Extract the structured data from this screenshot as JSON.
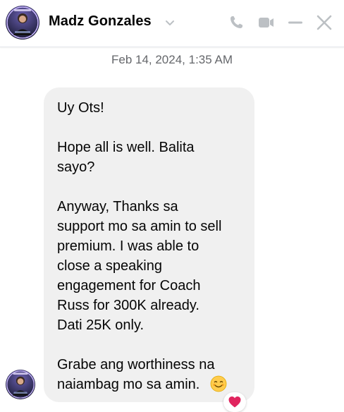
{
  "contact": {
    "name": "Madz Gonzales"
  },
  "header": {
    "icons": [
      "chevron-down-icon",
      "phone-icon",
      "video-icon",
      "minimize-icon",
      "close-icon"
    ],
    "icon_color": "#bcc0c4"
  },
  "conversation": {
    "timestamp": "Feb 14, 2024, 1:35 AM",
    "message": {
      "text": "Uy Ots!\n\nHope all is well. Balita\nsayo?\n\nAnyway, Thanks sa\nsupport mo sa amin to sell\npremium. I was able to\nclose a speaking\nengagement for Coach\nRuss for 300K already.\nDati 25K only.\n\nGrabe ang worthiness na\nnaiambag mo sa amin.",
      "emoji": "smiling-face-emoji",
      "reaction": "red-heart"
    }
  },
  "colors": {
    "bubble": "#f0f0f0",
    "timestamp": "#65676b",
    "reaction_heart": "#e0245e"
  }
}
